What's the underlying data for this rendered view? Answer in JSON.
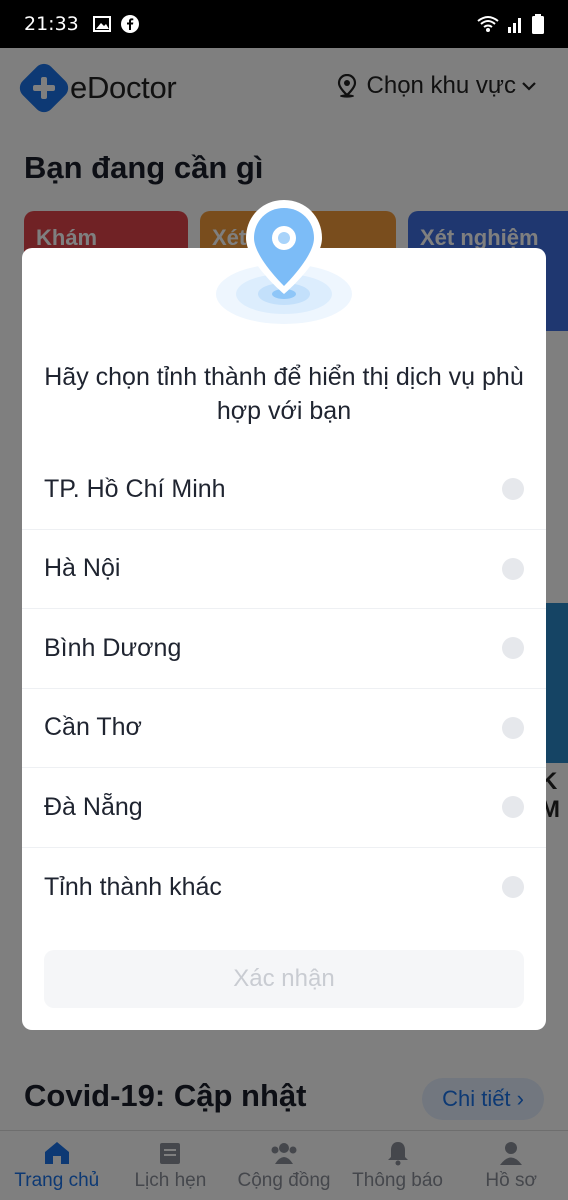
{
  "status_bar": {
    "time": "21:33"
  },
  "header": {
    "logo_text": "eDoctor",
    "region_label": "Chọn khu vực"
  },
  "home": {
    "section_title": "Bạn đang cần gì",
    "cards": [
      "Khám",
      "Xét",
      "Xét nghiệm"
    ],
    "right_peek_text": "K M",
    "covid_title": "Covid-19: Cập nhật",
    "detail_button": "Chi tiết ›"
  },
  "tabbar": {
    "items": [
      {
        "label": "Trang chủ",
        "icon": "home-icon"
      },
      {
        "label": "Lịch hẹn",
        "icon": "calendar-icon"
      },
      {
        "label": "Cộng đồng",
        "icon": "community-icon"
      },
      {
        "label": "Thông báo",
        "icon": "bell-icon"
      },
      {
        "label": "Hồ sơ",
        "icon": "profile-icon"
      }
    ],
    "active": 0
  },
  "modal": {
    "title": "Hãy chọn tỉnh thành để hiển thị dịch vụ phù hợp với bạn",
    "options": [
      {
        "label": "TP. Hồ Chí Minh",
        "selected": false
      },
      {
        "label": "Hà Nội",
        "selected": false
      },
      {
        "label": "Bình Dương",
        "selected": false
      },
      {
        "label": "Cần Thơ",
        "selected": false
      },
      {
        "label": "Đà Nẵng",
        "selected": false
      },
      {
        "label": "Tỉnh thành khác",
        "selected": false
      }
    ],
    "confirm_label": "Xác nhận",
    "confirm_enabled": false
  },
  "colors": {
    "accent": "#1a73e8",
    "pin": "#7cbcf7",
    "overlay": "rgba(0,0,0,0.5)"
  }
}
